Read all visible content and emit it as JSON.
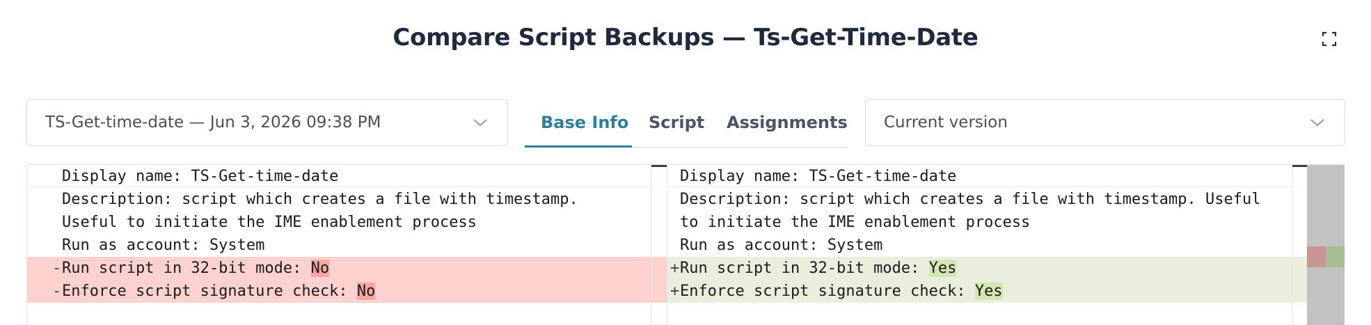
{
  "header": {
    "title": "Compare Script Backups — Ts-Get-Time-Date",
    "fullscreen_icon": "expand-icon"
  },
  "left_select": {
    "value": "TS-Get-time-date — Jun 3, 2026 09:38 PM",
    "icon": "chevron-down-icon"
  },
  "right_select": {
    "value": "Current version",
    "icon": "chevron-down-icon"
  },
  "tabs": [
    {
      "label": "Base Info",
      "active": true
    },
    {
      "label": "Script",
      "active": false
    },
    {
      "label": "Assignments",
      "active": false
    }
  ],
  "diff": {
    "left": {
      "lines": [
        {
          "text": "Display name: TS-Get-time-date"
        },
        {
          "text": "Description: script which creates a file with timestamp."
        },
        {
          "text": "Useful to initiate the IME enablement process"
        },
        {
          "text": "Run as account: System"
        },
        {
          "marker": "-",
          "prefix": "Run script in 32-bit mode: ",
          "highlight": "No"
        },
        {
          "marker": "-",
          "prefix": "Enforce script signature check: ",
          "highlight": "No"
        }
      ]
    },
    "right": {
      "lines": [
        {
          "text": "Display name: TS-Get-time-date"
        },
        {
          "text": "Description: script which creates a file with timestamp. Useful"
        },
        {
          "text": "to initiate the IME enablement process"
        },
        {
          "text": "Run as account: System"
        },
        {
          "marker": "+",
          "prefix": "Run script in 32-bit mode: ",
          "highlight": "Yes"
        },
        {
          "marker": "+",
          "prefix": "Enforce script signature check: ",
          "highlight": "Yes"
        }
      ]
    },
    "colors": {
      "deleted_line": "#ffd2d0",
      "deleted_word": "#f7a7a1",
      "inserted_line": "#e9efdc",
      "inserted_word": "#d4e7b2",
      "overview_ruler": "#c2c2c2"
    }
  },
  "colors": {
    "title": "#1f2a3c",
    "accent": "#2e8098",
    "tab_inactive": "#4b5563"
  }
}
